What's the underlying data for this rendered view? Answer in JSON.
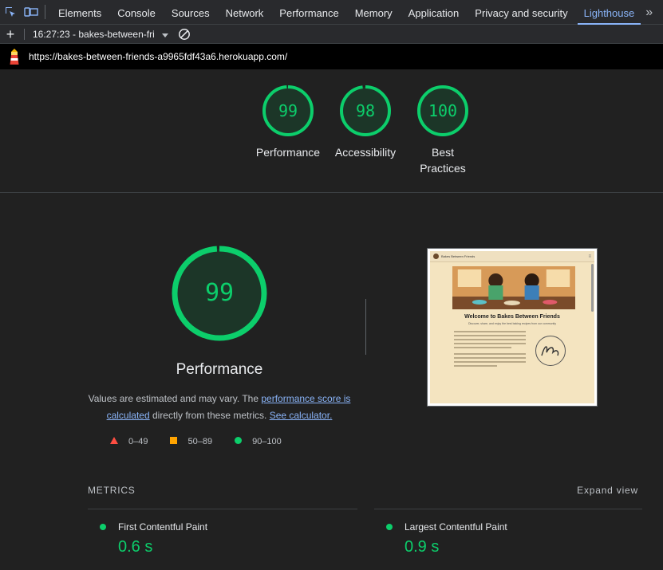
{
  "devtools": {
    "tabs": [
      "Elements",
      "Console",
      "Sources",
      "Network",
      "Performance",
      "Memory",
      "Application",
      "Privacy and security",
      "Lighthouse"
    ],
    "active_tab": "Lighthouse",
    "more": "»"
  },
  "toolbar": {
    "add": "+",
    "report_select": "16:27:23 - bakes-between-fri"
  },
  "url": "https://bakes-between-friends-a9965fdf43a6.herokuapp.com/",
  "gauges": [
    {
      "score": "99",
      "label": "Performance"
    },
    {
      "score": "98",
      "label": "Accessibility"
    },
    {
      "score": "100",
      "label": "Best Practices"
    }
  ],
  "main_gauge": {
    "score": "99",
    "title": "Performance"
  },
  "description": {
    "part1": "Values are estimated and may vary. The ",
    "link1": "performance score is calculated",
    "part2": " directly from these metrics. ",
    "link2": "See calculator."
  },
  "legend": [
    {
      "range": "0–49",
      "shape": "triangle",
      "color": "#ff4e42"
    },
    {
      "range": "50–89",
      "shape": "square",
      "color": "#ffa400"
    },
    {
      "range": "90–100",
      "shape": "circle",
      "color": "#0cce6b"
    }
  ],
  "screenshot": {
    "site_name": "Bakes Between Friends",
    "heading": "Welcome to Bakes Between Friends",
    "subheading": "Discover, share, and enjoy the best baking recipes from our community"
  },
  "metrics_section": {
    "title": "METRICS",
    "expand": "Expand view"
  },
  "metrics": [
    {
      "name": "First Contentful Paint",
      "value": "0.6 s"
    },
    {
      "name": "Largest Contentful Paint",
      "value": "0.9 s"
    }
  ],
  "colors": {
    "pass": "#0cce6b",
    "link": "#8ab4f8",
    "background": "#212121"
  }
}
